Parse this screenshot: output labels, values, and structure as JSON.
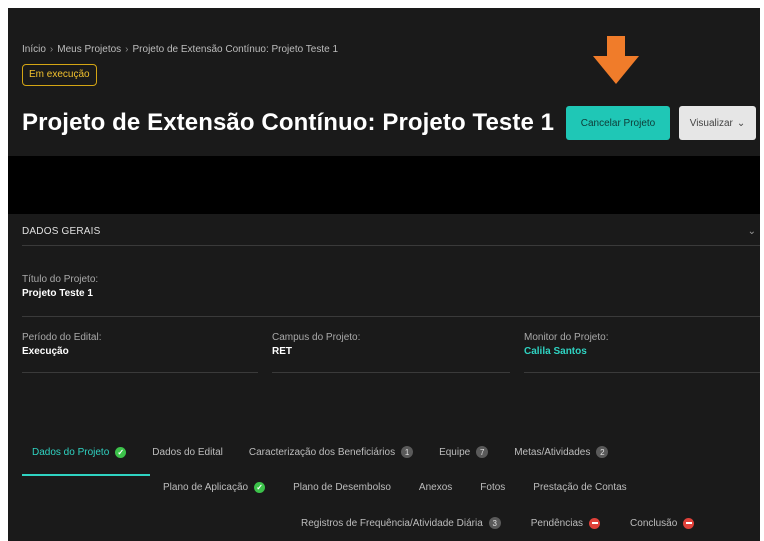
{
  "breadcrumb": [
    "Início",
    "Meus Projetos",
    "Projeto de Extensão Contínuo: Projeto Teste 1"
  ],
  "breadcrumb_sep": "›",
  "status_badge": "Em execução",
  "page_title": "Projeto de Extensão Contínuo: Projeto Teste 1",
  "buttons": {
    "cancel": "Cancelar Projeto",
    "view": "Visualizar",
    "view_caret": "⌄"
  },
  "arrow_color": "#f07c2a",
  "section": {
    "title": "DADOS GERAIS",
    "chevron": "⌄"
  },
  "fields": {
    "titulo": {
      "label": "Título do Projeto:",
      "value": "Projeto Teste 1"
    },
    "periodo": {
      "label": "Período do Edital:",
      "value": "Execução"
    },
    "campus": {
      "label": "Campus do Projeto:",
      "value": "RET"
    },
    "monitor": {
      "label": "Monitor do Projeto:",
      "value": "Calila Santos"
    }
  },
  "tabs": {
    "row1": [
      {
        "label": "Dados do Projeto",
        "icon": "check"
      },
      {
        "label": "Dados do Edital"
      },
      {
        "label": "Caracterização dos Beneficiários",
        "count": "1"
      },
      {
        "label": "Equipe",
        "count": "7"
      },
      {
        "label": "Metas/Atividades",
        "count": "2"
      }
    ],
    "row2": [
      {
        "label": "Plano de Aplicação",
        "icon": "check"
      },
      {
        "label": "Plano de Desembolso"
      },
      {
        "label": "Anexos"
      },
      {
        "label": "Fotos"
      },
      {
        "label": "Prestação de Contas"
      }
    ],
    "row3": [
      {
        "label": "Registros de Frequência/Atividade Diária",
        "count": "3"
      },
      {
        "label": "Pendências",
        "icon": "minus"
      },
      {
        "label": "Conclusão",
        "icon": "minus"
      }
    ]
  },
  "colors": {
    "accent": "#2fd3c2",
    "badge": "#f2c12e",
    "success": "#3cc24a",
    "danger": "#e0413a"
  }
}
